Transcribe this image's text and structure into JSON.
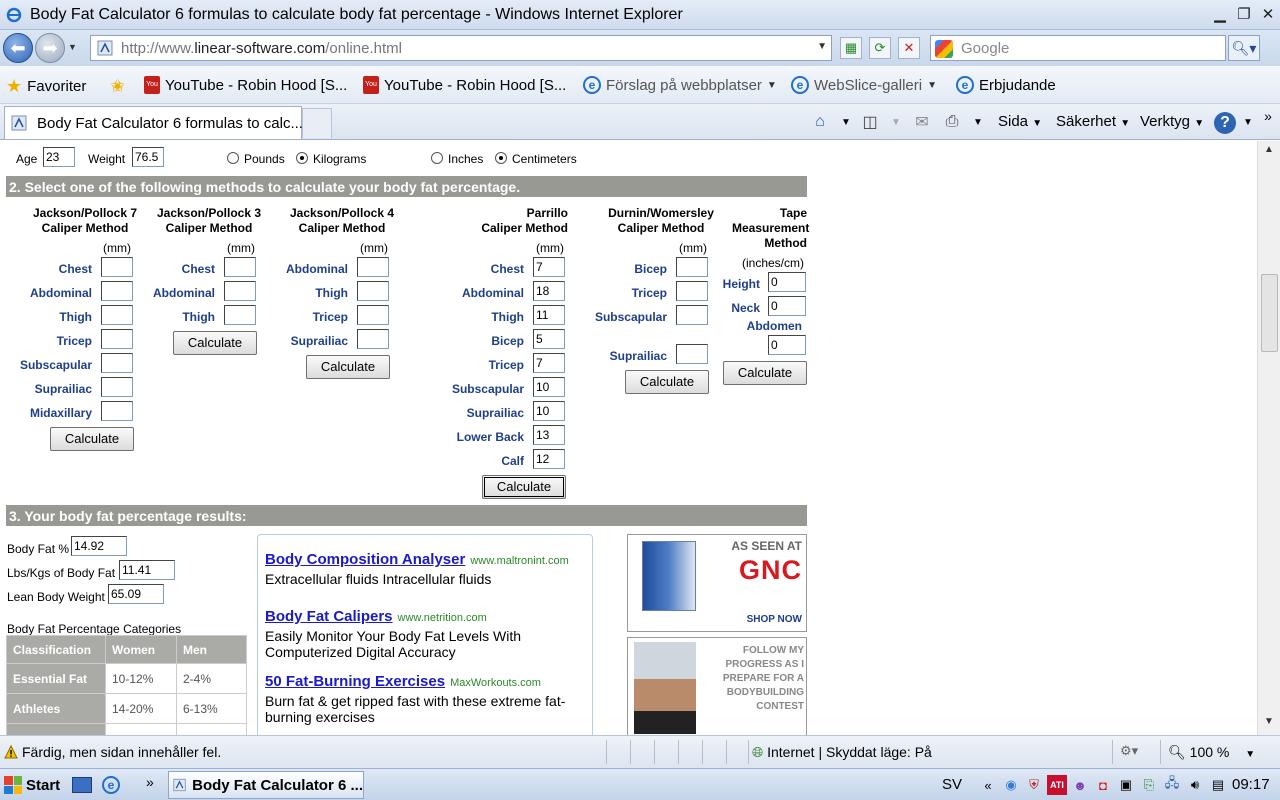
{
  "window": {
    "title": "Body Fat Calculator 6 formulas to calculate body fat percentage - Windows Internet Explorer"
  },
  "address": {
    "url_prefix": "http://www.",
    "url_domain": "linear-software.com",
    "url_path": "/online.html",
    "search_placeholder": "Google"
  },
  "favorites": {
    "label": "Favoriter",
    "items": [
      "YouTube - Robin Hood [S...",
      "YouTube - Robin Hood [S...",
      "Förslag på webbplatser",
      "WebSlice-galleri",
      "Erbjudande"
    ]
  },
  "tab": {
    "label": "Body Fat Calculator 6 formulas to calc..."
  },
  "commands": {
    "page": "Sida",
    "safety": "Säkerhet",
    "tools": "Verktyg"
  },
  "inputs": {
    "age_label": "Age",
    "age": "23",
    "weight_label": "Weight",
    "weight": "76.5",
    "pounds": "Pounds",
    "kilograms": "Kilograms",
    "inches": "Inches",
    "centimeters": "Centimeters"
  },
  "section2": {
    "heading": "2. Select one of the following methods to calculate your body fat percentage.",
    "calculate": "Calculate",
    "mm": "(mm)",
    "jp7": {
      "title1": "Jackson/Pollock 7",
      "title2": "Caliper Method",
      "fields": [
        "Chest",
        "Abdominal",
        "Thigh",
        "Tricep",
        "Subscapular",
        "Suprailiac",
        "Midaxillary"
      ]
    },
    "jp3": {
      "title1": "Jackson/Pollock 3",
      "title2": "Caliper Method",
      "fields": [
        "Chest",
        "Abdominal",
        "Thigh"
      ]
    },
    "jp4": {
      "title1": "Jackson/Pollock 4",
      "title2": "Caliper Method",
      "fields": [
        "Abdominal",
        "Thigh",
        "Tricep",
        "Suprailiac"
      ]
    },
    "parrillo": {
      "title1": "Parrillo",
      "title2": "Caliper Method",
      "fields": [
        "Chest",
        "Abdominal",
        "Thigh",
        "Bicep",
        "Tricep",
        "Subscapular",
        "Suprailiac",
        "Lower Back",
        "Calf"
      ],
      "values": [
        "7",
        "18",
        "11",
        "5",
        "7",
        "10",
        "10",
        "13",
        "12"
      ]
    },
    "durnin": {
      "title1": "Durnin/Womersley",
      "title2": "Caliper Method",
      "fields": [
        "Bicep",
        "Tricep",
        "Subscapular",
        "Suprailiac"
      ]
    },
    "tape": {
      "title1": "Tape",
      "title2": "Measurement",
      "title3": "Method",
      "unit": "(inches/cm)",
      "height_label": "Height",
      "height": "0",
      "neck_label": "Neck",
      "neck": "0",
      "abdomen_label": "Abdomen",
      "abdomen": "0"
    }
  },
  "section3": {
    "heading": "3. Your body fat percentage results:",
    "bodyfat_label": "Body Fat %",
    "bodyfat": "14.92",
    "lbs_label": "Lbs/Kgs of Body Fat",
    "lbs": "11.41",
    "lean_label": "Lean Body Weight",
    "lean": "65.09",
    "categories_title": "Body Fat Percentage Categories",
    "table_headers": [
      "Classification",
      "Women",
      "Men"
    ],
    "table_rows": [
      [
        "Essential Fat",
        "10-12%",
        "2-4%"
      ],
      [
        "Athletes",
        "14-20%",
        "6-13%"
      ]
    ]
  },
  "ads": [
    {
      "title": "Body Composition Analyser",
      "src": "www.maltronint.com",
      "text": "Extracellular fluids Intracellular fluids"
    },
    {
      "title": "Body Fat Calipers",
      "src": "www.netrition.com",
      "text": "Easily Monitor Your Body Fat Levels With Computerized Digital Accuracy"
    },
    {
      "title": "50 Fat-Burning Exercises",
      "src": "MaxWorkouts.com",
      "text": "Burn fat & get ripped fast with these extreme fat-burning exercises"
    }
  ],
  "banners": {
    "b1_top": "AS SEEN AT",
    "b1_brand": "GNC",
    "b1_cta": "SHOP NOW",
    "b2_text": "FOLLOW MY PROGRESS AS I PREPARE FOR A BODYBUILDING CONTEST"
  },
  "status": {
    "text": "Färdig, men sidan innehåller fel.",
    "zone": "Internet | Skyddat läge: På",
    "zoom": "100 %"
  },
  "taskbar": {
    "start": "Start",
    "item": "Body Fat Calculator 6 ...",
    "lang": "SV",
    "clock": "09:17"
  }
}
